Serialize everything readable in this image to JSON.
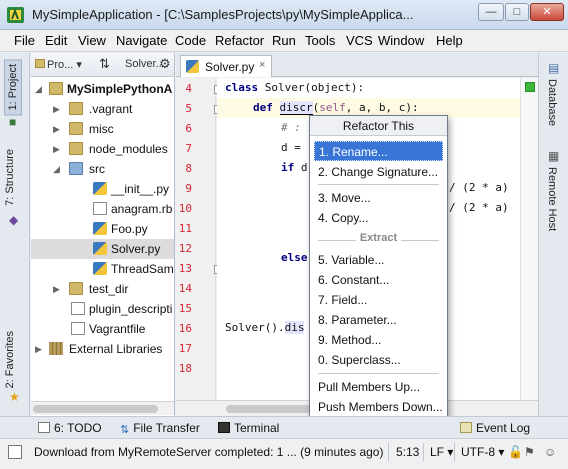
{
  "window": {
    "title": "MySimpleApplication - [C:\\SamplesProjects\\py\\MySimpleApplica...",
    "minimize": "—",
    "maximize": "□",
    "close": "✕"
  },
  "menu": [
    "File",
    "Edit",
    "View",
    "Navigate",
    "Code",
    "Refactor",
    "Run",
    "Tools",
    "VCS",
    "Window",
    "Help"
  ],
  "left_stripe": {
    "project_tab": "1: Project",
    "structure_tab": "7: Structure",
    "favorites_tab": "2: Favorites"
  },
  "right_stripe": {
    "database_tab": "Database",
    "remote_host_tab": "Remote Host"
  },
  "project_panel": {
    "view_selector": "Pro...",
    "settings_label": "Solver..."
  },
  "tree": [
    {
      "label": "MySimplePythonA",
      "bold": true
    },
    {
      "label": ".vagrant"
    },
    {
      "label": "misc"
    },
    {
      "label": "node_modules"
    },
    {
      "label": "src"
    },
    {
      "label": "__init__.py"
    },
    {
      "label": "anagram.rb"
    },
    {
      "label": "Foo.py"
    },
    {
      "label": "Solver.py"
    },
    {
      "label": "ThreadSamp"
    },
    {
      "label": "test_dir"
    },
    {
      "label": "plugin_descripti"
    },
    {
      "label": "Vagrantfile"
    },
    {
      "label": "External Libraries"
    }
  ],
  "editor": {
    "tab_label": "Solver.py",
    "tab_close": "×",
    "line_numbers": [
      "4",
      "5",
      "6",
      "7",
      "8",
      "9",
      "10",
      "11",
      "12",
      "13",
      "14",
      "15",
      "16",
      "17",
      "18"
    ],
    "code": {
      "l4_kw": "class",
      "l4_rest": " Solver(object):",
      "l5_kw": "def",
      "l5_name": "discr",
      "l5_paren": "(",
      "l5_self": "self",
      "l5_rest": ", a, b, c):",
      "l6": "# :",
      "l7": "d =",
      "l8_kw": "if",
      "l8_rest": " d",
      "l10": "/ (2 * a)",
      "l11": "/ (2 * a)",
      "l14": "else",
      "l18_a": "Solver().",
      "l18_b": "dis"
    }
  },
  "refactor_popup": {
    "title": "Refactor This",
    "items": [
      "1. Rename...",
      "2. Change Signature...",
      "3. Move...",
      "4. Copy..."
    ],
    "group_extract": "Extract",
    "extract_items": [
      "5. Variable...",
      "6. Constant...",
      "7. Field...",
      "8. Parameter...",
      "9. Method...",
      "0. Superclass..."
    ],
    "bottom_items": [
      "Pull Members Up...",
      "Push Members Down..."
    ]
  },
  "bottom_tabs": {
    "todo": "6: TODO",
    "file_transfer": "File Transfer",
    "terminal": "Terminal",
    "event_log": "Event Log"
  },
  "status": {
    "message": "Download from MyRemoteServer completed: 1 ... (9 minutes ago)",
    "position": "5:13",
    "line_sep": "LF",
    "encoding": "UTF-8"
  },
  "colors": {
    "selection": "#3875d7",
    "line_numbers": "#dd2233",
    "keyword": "#000080"
  }
}
